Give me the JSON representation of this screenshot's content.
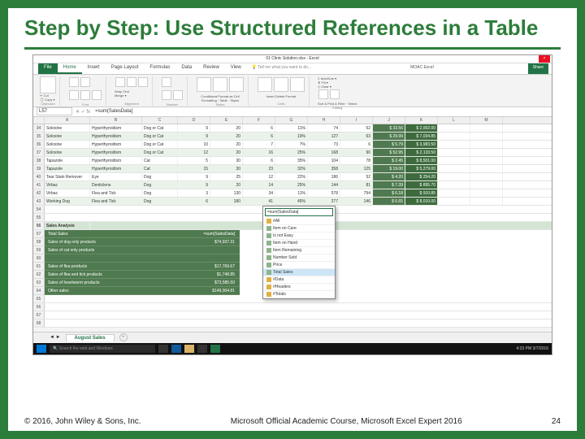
{
  "title": "Step by Step: Use Structured References in a Table",
  "footer": {
    "copyright": "© 2016, John Wiley & Sons, Inc.",
    "mid": "Microsoft Official Academic Course, Microsoft Excel Expert 2016",
    "page": "24"
  },
  "excel": {
    "window_title": "01 Clinic Solution.xlsx - Excel",
    "name_box": "L57",
    "formula": "=sum(SalesData[",
    "tell_me": "Tell me what you want to do...",
    "signin": "MOAC Excel",
    "ribbon_tabs": [
      "File",
      "Home",
      "Insert",
      "Page Layout",
      "Formulas",
      "Data",
      "Review",
      "View"
    ],
    "groups": [
      "Clipboard",
      "Font",
      "Alignment",
      "Number",
      "Styles",
      "Cells",
      "Editing"
    ],
    "sort_find": "Sort & Find & Filter · Select",
    "autosum": "AutoSum",
    "fill": "Fill",
    "clear": "Clear",
    "share": "Share",
    "columns": [
      "",
      "A",
      "B",
      "C",
      "D",
      "E",
      "F",
      "G",
      "H",
      "I",
      "J",
      "K",
      "L",
      "M"
    ],
    "rows": [
      {
        "n": "34",
        "a": "Soloxine",
        "b": "Hyperthyroidism",
        "c": "Dog or Cat",
        "d": "9",
        "e": "20",
        "f": "6",
        "g": "11%",
        "h": "74",
        "i": "52",
        "j": "$ 33.56",
        "k": "$ 2,002.00",
        "band": false
      },
      {
        "n": "35",
        "a": "Soloxine",
        "b": "Hyperthyroidism",
        "c": "Dog or Cat",
        "d": "9",
        "e": "20",
        "f": "6",
        "g": "19%",
        "h": "127",
        "i": "63",
        "j": "$ 29.99",
        "k": "$ 7,034.85",
        "band": true
      },
      {
        "n": "36",
        "a": "Soloxine",
        "b": "Hyperthyroidism",
        "c": "Dog or Cat",
        "d": "10",
        "e": "20",
        "f": "7",
        "g": "7%",
        "h": "73",
        "i": "6",
        "j": "$ 5.79",
        "k": "$ 3,983.50",
        "band": false
      },
      {
        "n": "37",
        "a": "Soloxine",
        "b": "Hyperthyroidism",
        "c": "Dog or Cat",
        "d": "12",
        "e": "20",
        "f": "16",
        "g": "25%",
        "h": "168",
        "i": "90",
        "j": "$ 52.95",
        "k": "$ 2,133.50",
        "band": true
      },
      {
        "n": "38",
        "a": "Tapazole",
        "b": "Hyperthyroidism",
        "c": "Cat",
        "d": "5",
        "e": "30",
        "f": "6",
        "g": "35%",
        "h": "104",
        "i": "78",
        "j": "$ 2.45",
        "k": "$ 8,501.00",
        "band": false
      },
      {
        "n": "39",
        "a": "Tapazole",
        "b": "Hyperthyroidism",
        "c": "Cat",
        "d": "15",
        "e": "30",
        "f": "23",
        "g": "32%",
        "h": "358",
        "i": "125",
        "j": "$ 19.00",
        "k": "$ 5,279.00",
        "band": true
      },
      {
        "n": "40",
        "a": "Tear Stain Remover",
        "b": "Eye",
        "c": "Dog",
        "d": "9",
        "e": "25",
        "f": "12",
        "g": "22%",
        "h": "186",
        "i": "52",
        "j": "$ 4.20",
        "k": "$ 254.20",
        "band": false
      },
      {
        "n": "41",
        "a": "Virbac",
        "b": "Denticlens",
        "c": "Dog",
        "d": "9",
        "e": "20",
        "f": "14",
        "g": "25%",
        "h": "144",
        "i": "81",
        "j": "$ 7.39",
        "k": "$ 895.70",
        "band": true
      },
      {
        "n": "42",
        "a": "Virbac",
        "b": "Flea and Tick",
        "c": "Dog",
        "d": "3",
        "e": "130",
        "f": "34",
        "g": "11%",
        "h": "578",
        "i": "794",
        "j": "$ 6.18",
        "k": "$ 910.85",
        "band": false
      },
      {
        "n": "43",
        "a": "Working Dog",
        "b": "Flea and Tick",
        "c": "Dog",
        "d": "6",
        "e": "180",
        "f": "41",
        "g": "45%",
        "h": "277",
        "i": "146",
        "j": "$ 6.65",
        "k": "$ 8,010.00",
        "band": true
      }
    ],
    "analysis_title": "Sales Analysis",
    "analysis": [
      {
        "label": "Total Sales",
        "value": "",
        "formula": "=sum(SalesData["
      },
      {
        "label": "Sales of dog only products",
        "value": "$74,937.31"
      },
      {
        "label": "Sales of cat only products",
        "value": ""
      },
      {
        "label": "",
        "value": ""
      },
      {
        "label": "Sales of flea products",
        "value": "$17,769.67"
      },
      {
        "label": "Sales of flea and tick products",
        "value": "$1,748.85"
      },
      {
        "label": "Sales of heartworm products",
        "value": "$73,585.50"
      },
      {
        "label": "Other sales",
        "value": "$149,004.81"
      }
    ],
    "dropdown": {
      "input": "=sum(SalesData[",
      "options": [
        {
          "t": "#All",
          "k": "fld"
        },
        {
          "t": "Item on Care",
          "k": "col"
        },
        {
          "t": "Is not Easy",
          "k": "col"
        },
        {
          "t": "Item on Hand",
          "k": "col"
        },
        {
          "t": "Item Remaining",
          "k": "col"
        },
        {
          "t": "Number Sold",
          "k": "col"
        },
        {
          "t": "Price",
          "k": "col"
        },
        {
          "t": "Total Sales",
          "k": "col",
          "sel": true
        },
        {
          "t": "#Data",
          "k": "fld"
        },
        {
          "t": "#Headers",
          "k": "fld"
        },
        {
          "t": "#Totals",
          "k": "fld"
        }
      ]
    },
    "sheet_tab": "August Sales",
    "search_placeholder": "Search the web and Windows",
    "clock": "4:33 PM\n3/7/2016"
  }
}
